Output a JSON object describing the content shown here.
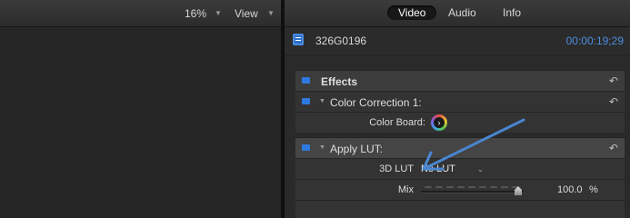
{
  "viewer": {
    "zoom": "16%",
    "zoom_chevron": "▼",
    "view_label": "View",
    "view_chevron": "▼"
  },
  "inspector": {
    "tabs": [
      {
        "label": "Video",
        "active": true
      },
      {
        "label": "Audio",
        "active": false
      },
      {
        "label": "Info",
        "active": false
      }
    ],
    "clip": {
      "icon": "film-clip-icon",
      "name": "326G0196",
      "timecode": "00:00:19;29"
    },
    "effects_header": "Effects",
    "color_correction": {
      "label": "Color Correction 1:",
      "color_board_label": "Color Board:",
      "color_board_icon": "color-board-icon",
      "color_board_glyph": "›"
    },
    "apply_lut": {
      "label": "Apply LUT:",
      "lut_label": "3D LUT",
      "lut_value": "No LUT",
      "lut_chevron": "⌄",
      "mix_label": "Mix",
      "mix_value": "100.0",
      "mix_unit": "%",
      "mix_level": 1.0
    },
    "reset_glyph": "↶"
  },
  "colors": {
    "accent_blue": "#2d79e0",
    "timecode_blue": "#4d8ee0",
    "annotation_arrow": "#4a86d0"
  }
}
